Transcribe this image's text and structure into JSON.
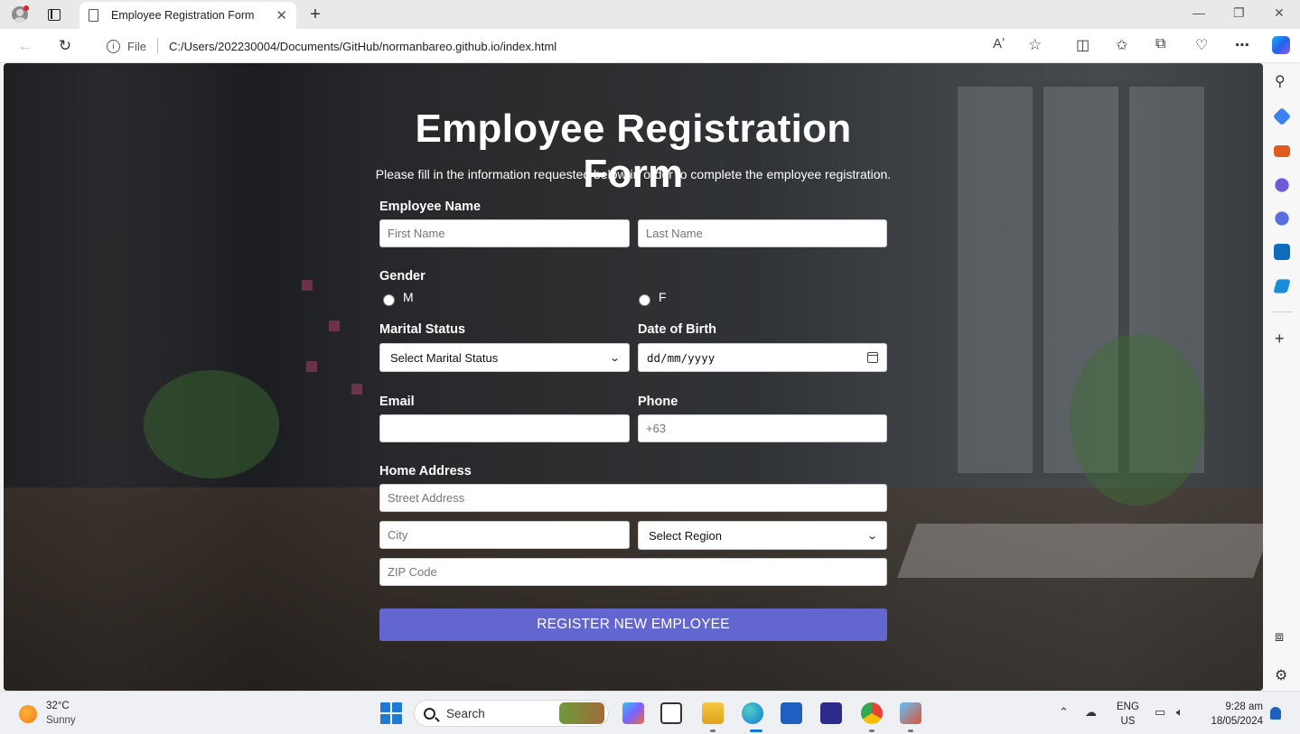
{
  "browser": {
    "tab_title": "Employee Registration Form",
    "address_scheme": "File",
    "url": "C:/Users/202230004/Documents/GitHub/normanbareo.github.io/index.html"
  },
  "form": {
    "title": "Employee Registration Form",
    "subtitle": "Please fill in the information requested below in order to complete the employee registration.",
    "employee_name": {
      "label": "Employee Name",
      "first_placeholder": "First Name",
      "last_placeholder": "Last Name"
    },
    "gender": {
      "label": "Gender",
      "options": [
        "M",
        "F"
      ]
    },
    "marital_status": {
      "label": "Marital Status",
      "selected": "Select Marital Status"
    },
    "date_of_birth": {
      "label": "Date of Birth",
      "value": "dd/mm/yyyy"
    },
    "email": {
      "label": "Email",
      "placeholder": ""
    },
    "phone": {
      "label": "Phone",
      "placeholder": "+63"
    },
    "home_address": {
      "label": "Home Address",
      "street_placeholder": "Street Address",
      "city_placeholder": "City",
      "region_selected": "Select Region",
      "zip_placeholder": "ZIP Code"
    },
    "submit_label": "REGISTER NEW EMPLOYEE",
    "submit_color": "#6366cf"
  },
  "taskbar": {
    "weather_temp": "32°C",
    "weather_desc": "Sunny",
    "search_label": "Search",
    "lang_1": "ENG",
    "lang_2": "US",
    "time": "9:28 am",
    "date": "18/05/2024"
  }
}
